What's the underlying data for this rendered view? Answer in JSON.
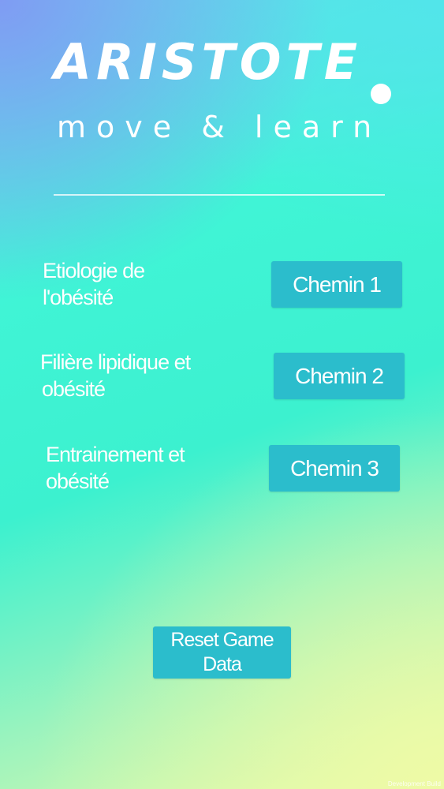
{
  "logo": {
    "title": "ARISTOTE",
    "subtitle": "move & learn"
  },
  "courses": [
    {
      "line1": "Etiologie de",
      "line2": "l'obésité",
      "button": "Chemin 1"
    },
    {
      "line1": "Filière lipidique  et",
      "line2": "obésité",
      "button": "Chemin 2"
    },
    {
      "line1": "Entrainement et",
      "line2": "obésité",
      "button": "Chemin 3"
    }
  ],
  "reset": {
    "line1": "Reset Game",
    "line2": "Data"
  },
  "footer": {
    "build_label": "Development Build"
  }
}
